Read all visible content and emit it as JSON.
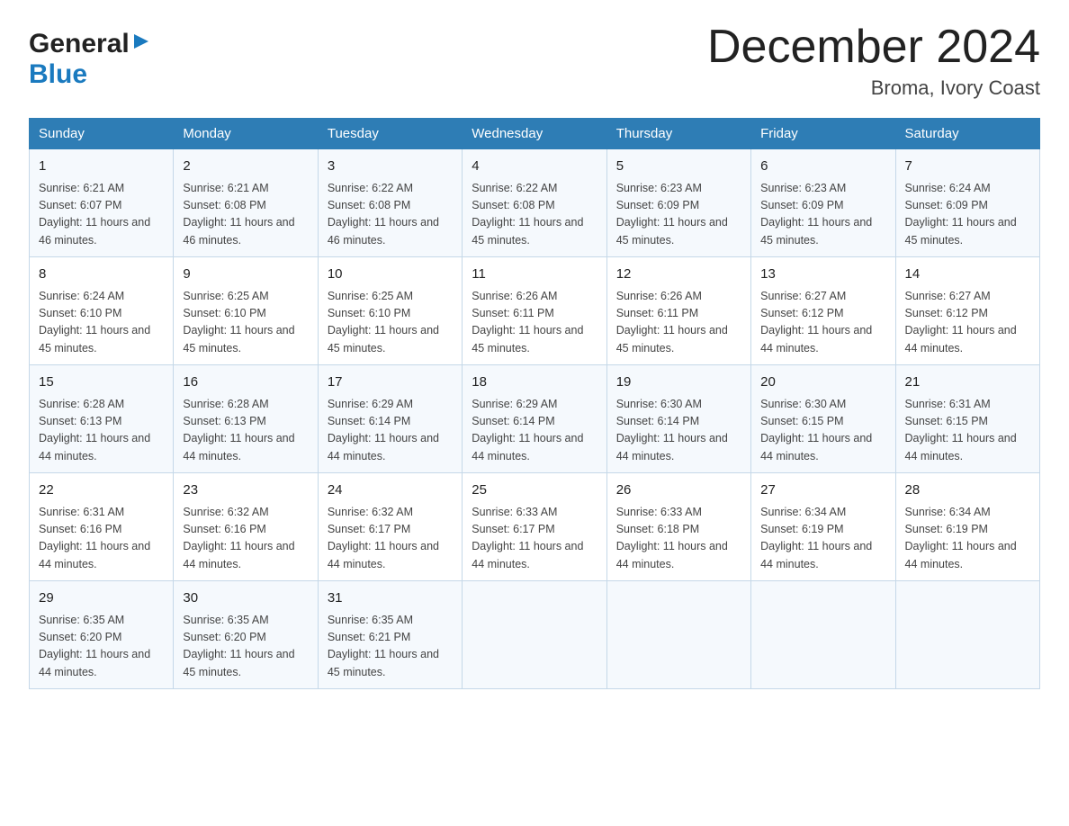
{
  "header": {
    "logo_general": "General",
    "logo_blue": "Blue",
    "month_title": "December 2024",
    "location": "Broma, Ivory Coast"
  },
  "columns": [
    "Sunday",
    "Monday",
    "Tuesday",
    "Wednesday",
    "Thursday",
    "Friday",
    "Saturday"
  ],
  "weeks": [
    [
      {
        "day": "1",
        "sunrise": "6:21 AM",
        "sunset": "6:07 PM",
        "daylight": "11 hours and 46 minutes."
      },
      {
        "day": "2",
        "sunrise": "6:21 AM",
        "sunset": "6:08 PM",
        "daylight": "11 hours and 46 minutes."
      },
      {
        "day": "3",
        "sunrise": "6:22 AM",
        "sunset": "6:08 PM",
        "daylight": "11 hours and 46 minutes."
      },
      {
        "day": "4",
        "sunrise": "6:22 AM",
        "sunset": "6:08 PM",
        "daylight": "11 hours and 45 minutes."
      },
      {
        "day": "5",
        "sunrise": "6:23 AM",
        "sunset": "6:09 PM",
        "daylight": "11 hours and 45 minutes."
      },
      {
        "day": "6",
        "sunrise": "6:23 AM",
        "sunset": "6:09 PM",
        "daylight": "11 hours and 45 minutes."
      },
      {
        "day": "7",
        "sunrise": "6:24 AM",
        "sunset": "6:09 PM",
        "daylight": "11 hours and 45 minutes."
      }
    ],
    [
      {
        "day": "8",
        "sunrise": "6:24 AM",
        "sunset": "6:10 PM",
        "daylight": "11 hours and 45 minutes."
      },
      {
        "day": "9",
        "sunrise": "6:25 AM",
        "sunset": "6:10 PM",
        "daylight": "11 hours and 45 minutes."
      },
      {
        "day": "10",
        "sunrise": "6:25 AM",
        "sunset": "6:10 PM",
        "daylight": "11 hours and 45 minutes."
      },
      {
        "day": "11",
        "sunrise": "6:26 AM",
        "sunset": "6:11 PM",
        "daylight": "11 hours and 45 minutes."
      },
      {
        "day": "12",
        "sunrise": "6:26 AM",
        "sunset": "6:11 PM",
        "daylight": "11 hours and 45 minutes."
      },
      {
        "day": "13",
        "sunrise": "6:27 AM",
        "sunset": "6:12 PM",
        "daylight": "11 hours and 44 minutes."
      },
      {
        "day": "14",
        "sunrise": "6:27 AM",
        "sunset": "6:12 PM",
        "daylight": "11 hours and 44 minutes."
      }
    ],
    [
      {
        "day": "15",
        "sunrise": "6:28 AM",
        "sunset": "6:13 PM",
        "daylight": "11 hours and 44 minutes."
      },
      {
        "day": "16",
        "sunrise": "6:28 AM",
        "sunset": "6:13 PM",
        "daylight": "11 hours and 44 minutes."
      },
      {
        "day": "17",
        "sunrise": "6:29 AM",
        "sunset": "6:14 PM",
        "daylight": "11 hours and 44 minutes."
      },
      {
        "day": "18",
        "sunrise": "6:29 AM",
        "sunset": "6:14 PM",
        "daylight": "11 hours and 44 minutes."
      },
      {
        "day": "19",
        "sunrise": "6:30 AM",
        "sunset": "6:14 PM",
        "daylight": "11 hours and 44 minutes."
      },
      {
        "day": "20",
        "sunrise": "6:30 AM",
        "sunset": "6:15 PM",
        "daylight": "11 hours and 44 minutes."
      },
      {
        "day": "21",
        "sunrise": "6:31 AM",
        "sunset": "6:15 PM",
        "daylight": "11 hours and 44 minutes."
      }
    ],
    [
      {
        "day": "22",
        "sunrise": "6:31 AM",
        "sunset": "6:16 PM",
        "daylight": "11 hours and 44 minutes."
      },
      {
        "day": "23",
        "sunrise": "6:32 AM",
        "sunset": "6:16 PM",
        "daylight": "11 hours and 44 minutes."
      },
      {
        "day": "24",
        "sunrise": "6:32 AM",
        "sunset": "6:17 PM",
        "daylight": "11 hours and 44 minutes."
      },
      {
        "day": "25",
        "sunrise": "6:33 AM",
        "sunset": "6:17 PM",
        "daylight": "11 hours and 44 minutes."
      },
      {
        "day": "26",
        "sunrise": "6:33 AM",
        "sunset": "6:18 PM",
        "daylight": "11 hours and 44 minutes."
      },
      {
        "day": "27",
        "sunrise": "6:34 AM",
        "sunset": "6:19 PM",
        "daylight": "11 hours and 44 minutes."
      },
      {
        "day": "28",
        "sunrise": "6:34 AM",
        "sunset": "6:19 PM",
        "daylight": "11 hours and 44 minutes."
      }
    ],
    [
      {
        "day": "29",
        "sunrise": "6:35 AM",
        "sunset": "6:20 PM",
        "daylight": "11 hours and 44 minutes."
      },
      {
        "day": "30",
        "sunrise": "6:35 AM",
        "sunset": "6:20 PM",
        "daylight": "11 hours and 45 minutes."
      },
      {
        "day": "31",
        "sunrise": "6:35 AM",
        "sunset": "6:21 PM",
        "daylight": "11 hours and 45 minutes."
      },
      null,
      null,
      null,
      null
    ]
  ]
}
